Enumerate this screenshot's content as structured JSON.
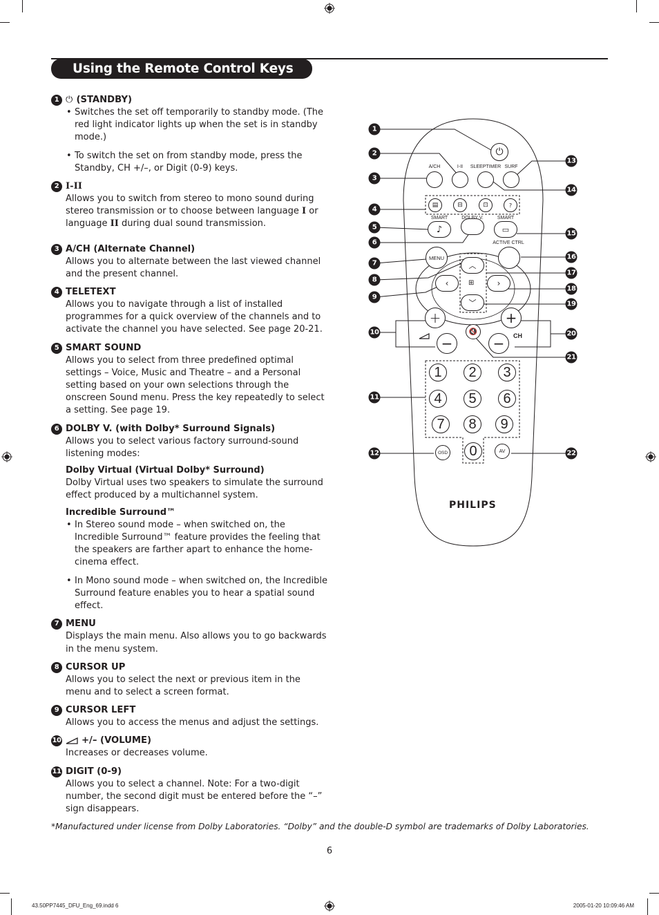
{
  "page": {
    "title": "Using the Remote Control Keys",
    "page_number": "6",
    "footnote": "*Manufactured under license from Dolby Laboratories. “Dolby” and the double-D symbol are trademarks of Dolby Laboratories.",
    "slug_left": "43.50PP7445_DFU_Eng_69.indd   6",
    "slug_right": "2005-01-20   10:09:46 AM"
  },
  "sections": [
    {
      "num": "1",
      "icon": "power-icon",
      "icon_glyph": "⏻",
      "heading": "(STANDBY)",
      "bullets": [
        "Switches the set off temporarily to standby mode. (The red light indicator lights up when the set is in standby mode.)",
        "To switch the set on from standby mode, press the Standby, CH +/–, or Digit (0-9) keys."
      ]
    },
    {
      "num": "2",
      "heading": "I-II",
      "body_a": "Allows you to switch from stereo to mono sound during stereo transmission or to choose between language ",
      "roman_1": "I",
      "body_b": " or language ",
      "roman_2": "II",
      "body_c": " during dual sound transmission."
    },
    {
      "num": "3",
      "heading": "A/CH (Alternate Channel)",
      "body": "Allows you to alternate between the last viewed channel and the present channel."
    },
    {
      "num": "4",
      "heading": "TELETEXT",
      "body": "Allows you to navigate through a list of installed programmes for a quick overview of the channels and to activate the channel you have selected. See page 20-21."
    },
    {
      "num": "5",
      "heading": "SMART SOUND",
      "body": "Allows you to select from three predefined optimal settings – Voice, Music and Theatre – and a Personal setting based on your own selections through the onscreen Sound menu. Press the key repeatedly to select a setting. See page 19."
    },
    {
      "num": "6",
      "heading": "DOLBY V. (with Dolby* Surround Signals)",
      "body": "Allows you to select various factory surround-sound listening modes:",
      "sub1_heading": "Dolby Virtual (Virtual Dolby* Surround)",
      "sub1_body": "Dolby Virtual uses two speakers to simulate the surround effect produced by a multichannel system.",
      "sub2_heading": "Incredible Surround™",
      "sub2_bullets": [
        "In Stereo sound mode – when switched on, the Incredible Surround™ feature provides the feeling that the speakers are farther apart to enhance the home-cinema effect.",
        "In Mono sound mode – when switched on, the Incredible Surround feature enables you to hear a spatial sound effect."
      ]
    },
    {
      "num": "7",
      "heading": "MENU",
      "body": "Displays the main menu. Also allows you to go backwards in the menu system."
    },
    {
      "num": "8",
      "heading": "CURSOR UP",
      "body": "Allows you to select the next or previous item in the menu and to select a screen format."
    },
    {
      "num": "9",
      "heading": "CURSOR LEFT",
      "body": "Allows you to access the menus and adjust the settings."
    },
    {
      "num": "10",
      "icon": "volume-icon",
      "icon_glyph": "◿",
      "heading": "+/– (VOLUME)",
      "body": "Increases or decreases volume."
    },
    {
      "num": "11",
      "heading": "DIGIT (0-9)",
      "body": "Allows you to select a channel. Note: For a two-digit number, the second digit must be entered before the “–” sign disappears."
    }
  ],
  "remote": {
    "brand": "PHILIPS",
    "labels": {
      "ach": "A/CH",
      "i_ii": "I-II",
      "sleeptimer": "SLEEPTIMER",
      "surf": "SURF",
      "smart_sound": "SMART",
      "dolby_v": "DOLBY V.",
      "smart_picture": "SMART",
      "active_ctrl": "ACTIVE CTRL",
      "menu": "MENU",
      "ch": "CH",
      "osd": "OSD",
      "av": "AV"
    },
    "digits": [
      "1",
      "2",
      "3",
      "4",
      "5",
      "6",
      "7",
      "8",
      "9",
      "0"
    ],
    "callouts_left": [
      "1",
      "2",
      "3",
      "4",
      "5",
      "6",
      "7",
      "8",
      "9",
      "10",
      "11",
      "12"
    ],
    "callouts_right": [
      "13",
      "14",
      "15",
      "16",
      "17",
      "18",
      "19",
      "20",
      "21",
      "22"
    ]
  }
}
